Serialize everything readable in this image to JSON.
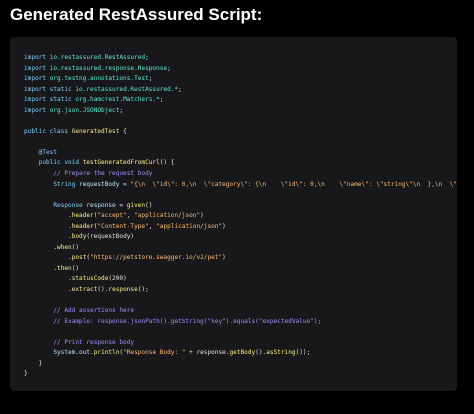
{
  "page": {
    "title": "Generated RestAssured Script:"
  },
  "code": {
    "lines": [
      [
        [
          "kw",
          "import "
        ],
        [
          "pkg",
          "io.restassured.RestAssured"
        ],
        [
          "txt",
          ";"
        ]
      ],
      [
        [
          "kw",
          "import "
        ],
        [
          "pkg",
          "io.restassured.response.Response"
        ],
        [
          "txt",
          ";"
        ]
      ],
      [
        [
          "kw",
          "import "
        ],
        [
          "pkg",
          "org.testng.annotations.Test"
        ],
        [
          "txt",
          ";"
        ]
      ],
      [
        [
          "kw",
          "import static "
        ],
        [
          "pkg",
          "io.restassured.RestAssured.*"
        ],
        [
          "txt",
          ";"
        ]
      ],
      [
        [
          "kw",
          "import static "
        ],
        [
          "pkg",
          "org.hamcrest.Matchers.*"
        ],
        [
          "txt",
          ";"
        ]
      ],
      [
        [
          "kw",
          "import "
        ],
        [
          "pkg",
          "org.json.JSONObject"
        ],
        [
          "txt",
          ";"
        ]
      ],
      [],
      [
        [
          "kw",
          "public class "
        ],
        [
          "cls",
          "GeneratedTest"
        ],
        [
          "txt",
          " {"
        ]
      ],
      [],
      [
        [
          "ann",
          "    @Test"
        ]
      ],
      [
        [
          "kw",
          "    public void "
        ],
        [
          "fn",
          "testGeneratedFromCurl"
        ],
        [
          "txt",
          "() {"
        ]
      ],
      [
        [
          "cmt",
          "        // Prepare the request body"
        ]
      ],
      [
        [
          "kw",
          "        String "
        ],
        [
          "var",
          "requestBody"
        ],
        [
          "txt",
          " = "
        ],
        [
          "str",
          "\"{\\n  \\\"id\\\": 0,\\n  \\\"category\\\": {\\n    \\\"id\\\": 0,\\n    \\\"name\\\": \\\"string\\\"\\n  },\\n  \\\"name\\\""
        ]
      ],
      [],
      [
        [
          "kw",
          "        Response "
        ],
        [
          "var",
          "response"
        ],
        [
          "txt",
          " = "
        ],
        [
          "fn",
          "given"
        ],
        [
          "txt",
          "()"
        ]
      ],
      [
        [
          "txt",
          "            ."
        ],
        [
          "fn",
          "header"
        ],
        [
          "txt",
          "("
        ],
        [
          "str",
          "\"accept\""
        ],
        [
          "txt",
          ", "
        ],
        [
          "str",
          "\"application/json\""
        ],
        [
          "txt",
          ")"
        ]
      ],
      [
        [
          "txt",
          "            ."
        ],
        [
          "fn",
          "header"
        ],
        [
          "txt",
          "("
        ],
        [
          "str",
          "\"Content-Type\""
        ],
        [
          "txt",
          ", "
        ],
        [
          "str",
          "\"application/json\""
        ],
        [
          "txt",
          ")"
        ]
      ],
      [
        [
          "txt",
          "            ."
        ],
        [
          "fn",
          "body"
        ],
        [
          "txt",
          "(requestBody)"
        ]
      ],
      [
        [
          "txt",
          "        ."
        ],
        [
          "fn",
          "when"
        ],
        [
          "txt",
          "()"
        ]
      ],
      [
        [
          "txt",
          "            ."
        ],
        [
          "fn",
          "post"
        ],
        [
          "txt",
          "("
        ],
        [
          "str",
          "\"https://petstore.swagger.io/v2/pet\""
        ],
        [
          "txt",
          ")"
        ]
      ],
      [
        [
          "txt",
          "        ."
        ],
        [
          "fn",
          "then"
        ],
        [
          "txt",
          "()"
        ]
      ],
      [
        [
          "txt",
          "            ."
        ],
        [
          "fn",
          "statusCode"
        ],
        [
          "txt",
          "(200)"
        ]
      ],
      [
        [
          "txt",
          "            ."
        ],
        [
          "fn",
          "extract"
        ],
        [
          "txt",
          "()."
        ],
        [
          "fn",
          "response"
        ],
        [
          "txt",
          "();"
        ]
      ],
      [],
      [
        [
          "cmt",
          "        // Add assertions here"
        ]
      ],
      [
        [
          "cmt",
          "        // Example: response.jsonPath().getString(\"key\").equals(\"expectedValue\");"
        ]
      ],
      [],
      [
        [
          "cmt",
          "        // Print response body"
        ]
      ],
      [
        [
          "var",
          "        System"
        ],
        [
          "txt",
          "."
        ],
        [
          "var",
          "out"
        ],
        [
          "txt",
          "."
        ],
        [
          "fn",
          "println"
        ],
        [
          "txt",
          "("
        ],
        [
          "str",
          "\"Response Body: \""
        ],
        [
          "txt",
          " + response."
        ],
        [
          "fn",
          "getBody"
        ],
        [
          "txt",
          "()."
        ],
        [
          "fn",
          "asString"
        ],
        [
          "txt",
          "());"
        ]
      ],
      [
        [
          "txt",
          "    }"
        ]
      ],
      [
        [
          "txt",
          "}"
        ]
      ]
    ]
  },
  "colors": {
    "background": "#000000",
    "panel": "#18181b",
    "keyword": "#7dd3fc",
    "string": "#fdba74",
    "comment": "#a78bfa"
  }
}
